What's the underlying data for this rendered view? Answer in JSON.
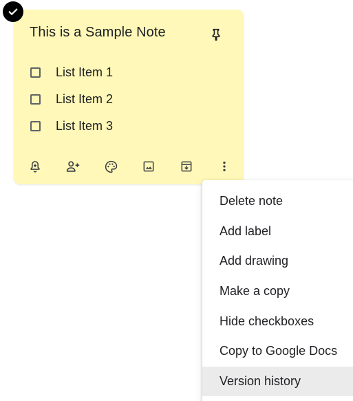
{
  "note": {
    "title": "This is a Sample Note",
    "background_color": "#fff8b8",
    "checklist": [
      {
        "label": "List Item 1",
        "checked": false
      },
      {
        "label": "List Item 2",
        "checked": false
      },
      {
        "label": "List Item 3",
        "checked": false
      }
    ],
    "selected": true,
    "toolbar_icons": [
      "reminder-bell-icon",
      "collaborator-icon",
      "palette-icon",
      "image-icon",
      "archive-icon",
      "more-vert-icon"
    ]
  },
  "context_menu": {
    "items": [
      {
        "label": "Delete note"
      },
      {
        "label": "Add label"
      },
      {
        "label": "Add drawing"
      },
      {
        "label": "Make a copy"
      },
      {
        "label": "Hide checkboxes"
      },
      {
        "label": "Copy to Google Docs"
      },
      {
        "label": "Version history",
        "hovered": true
      }
    ]
  }
}
